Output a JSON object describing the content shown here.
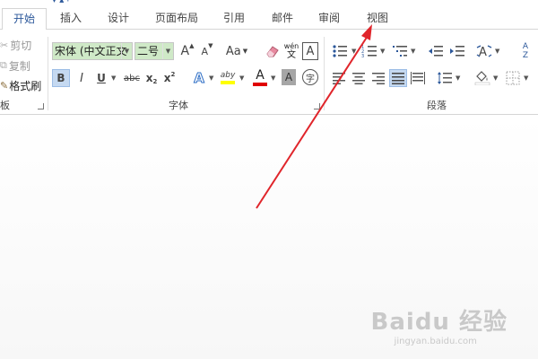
{
  "tabs": [
    {
      "label": "开始",
      "active": true
    },
    {
      "label": "插入"
    },
    {
      "label": "设计"
    },
    {
      "label": "页面布局"
    },
    {
      "label": "引用"
    },
    {
      "label": "邮件"
    },
    {
      "label": "审阅"
    },
    {
      "label": "视图"
    }
  ],
  "clipboard": {
    "cut_label": "剪切",
    "copy_label": "复制",
    "format_painter_label": "格式刷",
    "group_label_partial": "板"
  },
  "font": {
    "font_name": "宋体 (中文正文",
    "font_size": "二号",
    "grow_label": "A",
    "shrink_label": "A",
    "case_label": "Aa",
    "phonetic_top": "wén",
    "phonetic_bottom": "文",
    "border_char": "A",
    "bold_label": "B",
    "italic_label": "I",
    "underline_label": "U",
    "strike_label": "abc",
    "subscript_label": "x",
    "subscript_mark": "2",
    "superscript_label": "x",
    "superscript_mark": "2",
    "effects_label": "A",
    "highlight_label": "aby",
    "font_color_label": "A",
    "shading_label": "A",
    "enclose_label": "字",
    "group_label": "字体"
  },
  "paragraph": {
    "sort_label": "A\nZ",
    "group_label": "段落"
  },
  "colors": {
    "accent": "#2b579a",
    "highlight": "#ffff00",
    "font_color": "#e00000",
    "arrow": "#e0252b",
    "selected_fill": "#c5d9f1",
    "font_combo_fill": "#cfe9c7"
  },
  "watermark": {
    "brand": "Baidu 经验",
    "url": "jingyan.baidu.com"
  }
}
